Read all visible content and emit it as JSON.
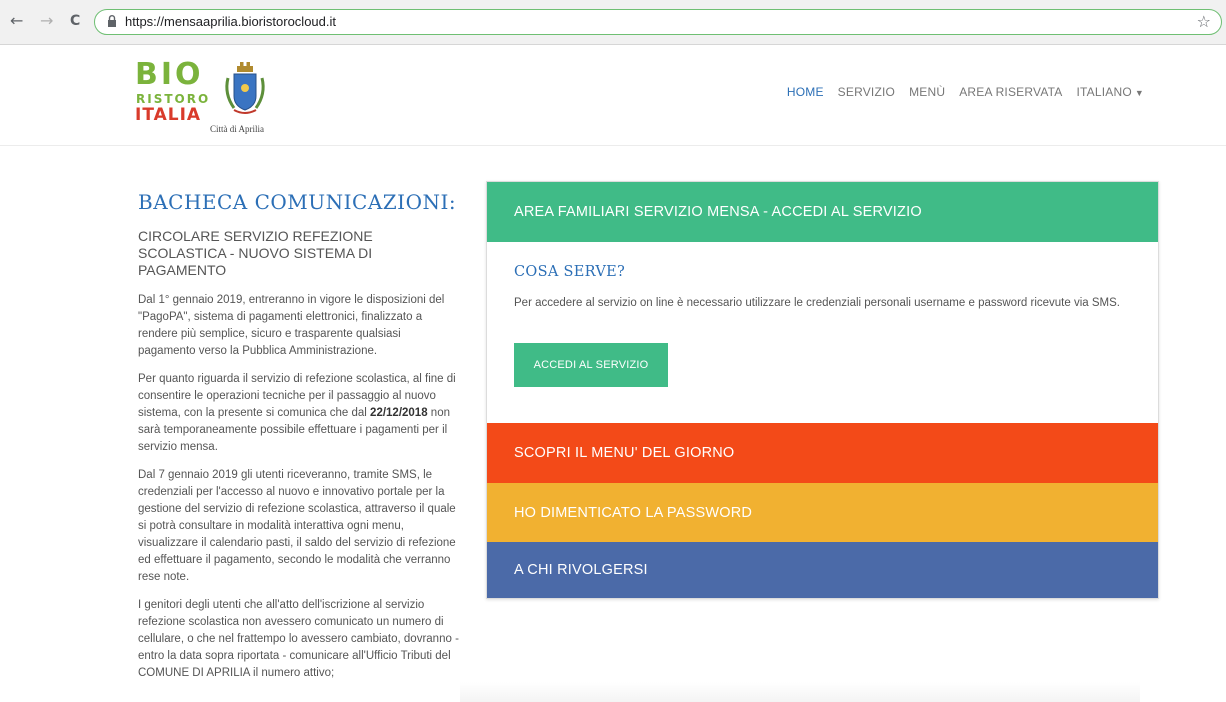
{
  "browser": {
    "back_glyph": "←",
    "forward_glyph": "→",
    "reload_glyph": "C",
    "url": "https://mensaaprilia.bioristorocloud.it",
    "star_glyph": "☆",
    "icons": [
      "back-arrow-icon",
      "forward-arrow-icon",
      "reload-icon",
      "lock-icon",
      "bookmark-star-icon"
    ]
  },
  "logo": {
    "bio": "BIO",
    "ristoro": "RISTORO",
    "italia": "ITALIA",
    "city": "Città di Aprilia",
    "icon": "city-crest-icon"
  },
  "nav": {
    "home": "HOME",
    "servizio": "SERVIZIO",
    "menu": "MENÙ",
    "area_riservata": "AREA RISERVATA",
    "language": "ITALIANO",
    "caret": "▼"
  },
  "board": {
    "title": "BACHECA COMUNICAZIONI:",
    "circular_title": "CIRCOLARE SERVIZIO REFEZIONE SCOLASTICA - NUOVO SISTEMA DI PAGAMENTO",
    "p1": "Dal 1° gennaio 2019, entreranno in vigore le disposizioni del \"PagoPA\", sistema di pagamenti elettronici, finalizzato a rendere più semplice, sicuro e trasparente qualsiasi pagamento verso la Pubblica Amministrazione.",
    "p2_before": "Per quanto riguarda il servizio di refezione scolastica, al fine di consentire le operazioni tecniche per il passaggio al nuovo sistema, con la presente si comunica che dal ",
    "p2_date": "22/12/2018",
    "p2_after": " non sarà temporaneamente possibile effettuare i pagamenti per il servizio mensa.",
    "p3": "Dal 7 gennaio 2019 gli utenti riceveranno, tramite SMS, le credenziali per l'accesso al nuovo e innovativo portale per la gestione del servizio di refezione scolastica, attraverso il quale si potrà consultare in modalità interattiva ogni menu, visualizzare il calendario pasti, il saldo del servizio di refezione ed effettuare il pagamento, secondo le modalità che verranno rese note.",
    "p4": "I genitori degli utenti che all'atto dell'iscrizione al servizio refezione scolastica non avessero comunicato un numero di cellulare, o che nel frattempo lo avessero cambiato, dovranno - entro la data sopra riportata - comunicare all'Ufficio Tributi del COMUNE DI APRILIA il numero attivo;"
  },
  "panel": {
    "access_bar": "AREA FAMILIARI SERVIZIO MENSA - ACCEDI AL SERVIZIO",
    "cosa_serve_title": "COSA SERVE?",
    "cosa_serve_text": "Per accedere al servizio on line è necessario utilizzare le credenziali personali username e password ricevute via SMS.",
    "cta_label": "ACCEDI AL SERVIZIO",
    "menu_bar": "SCOPRI IL MENU' DEL GIORNO",
    "password_bar": "HO DIMENTICATO LA PASSWORD",
    "contact_bar": "A CHI RIVOLGERSI"
  },
  "colors": {
    "green": "#40bb87",
    "red": "#f34a18",
    "yellow": "#f1b131",
    "blue": "#4b6aa8",
    "link_blue": "#2c6fb6"
  }
}
